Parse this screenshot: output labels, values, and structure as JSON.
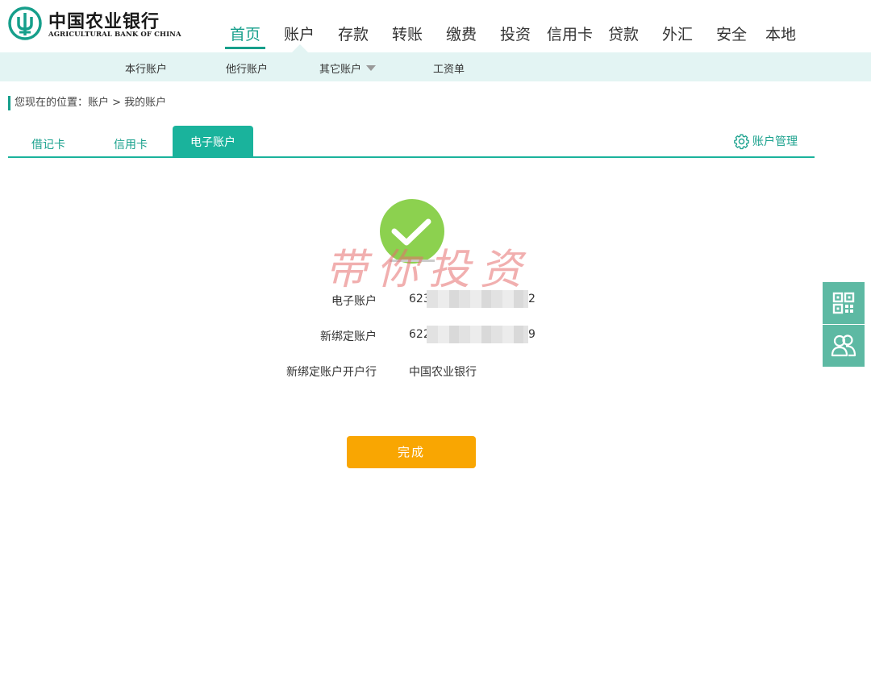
{
  "bank": {
    "name_cn": "中国农业银行",
    "name_en": "AGRICULTURAL BANK OF CHINA"
  },
  "main_nav": [
    "首页",
    "账户",
    "存款",
    "转账",
    "缴费",
    "投资",
    "信用卡",
    "贷款",
    "外汇",
    "安全",
    "本地"
  ],
  "sub_nav": {
    "own_accounts": "本行账户",
    "other_accounts": "他行账户",
    "more_accounts": "其它账户",
    "payroll": "工资单"
  },
  "breadcrumb": "您现在的位置：账户 > 我的账户",
  "tabs": {
    "debit": "借记卡",
    "credit": "信用卡",
    "e_account": "电子账户"
  },
  "account_management": "账户管理",
  "result": {
    "e_account_label": "电子账户",
    "e_account_prefix": "623",
    "e_account_suffix": "2",
    "bound_account_label": "新绑定账户",
    "bound_account_prefix": "622",
    "bound_account_suffix": "9",
    "bound_bank_label": "新绑定账户开户行",
    "bound_bank_value": "中国农业银行"
  },
  "watermark": "带你投资",
  "done_button": "完成",
  "icons": {
    "qr": "qr-code-icon",
    "service": "customer-service-icon",
    "success": "check-circle-icon",
    "settings": "gear-icon"
  },
  "colors": {
    "accent": "#169f8b",
    "tab_active": "#1ab39c",
    "success": "#8cd14f",
    "button": "#f9a602",
    "side": "#5db9a3"
  }
}
